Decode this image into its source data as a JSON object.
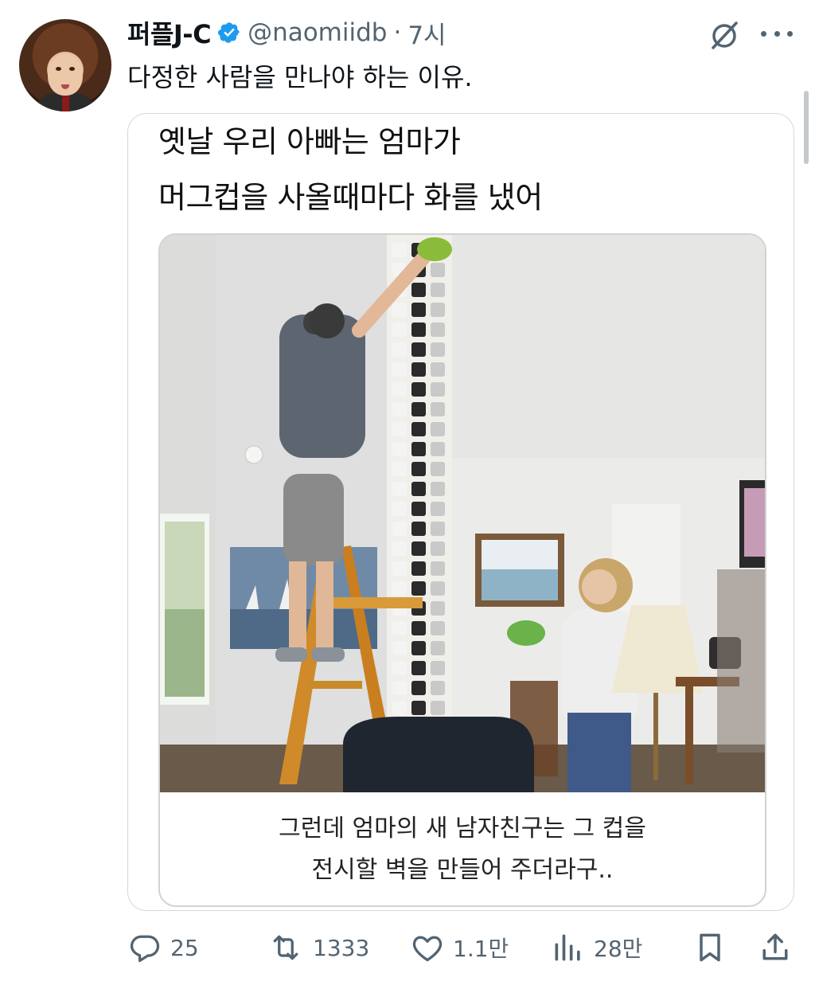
{
  "tweet": {
    "author": {
      "display_name": "퍼플J-C",
      "handle": "@naomiidb",
      "verified": true
    },
    "separator": "·",
    "time": "7시",
    "text": "다정한 사람을 만나야 하는 이유.",
    "media": {
      "caption_top": [
        "옛날 우리 아빠는 엄마가",
        "머그컵을 사올때마다 화를 냈어"
      ],
      "caption_bottom": [
        "그런데 엄마의 새 남자친구는 그 컵을",
        "전시할 벽을 만들어 주더라구.."
      ]
    },
    "actions": {
      "reply": {
        "icon": "reply-icon",
        "count": "25"
      },
      "retweet": {
        "icon": "retweet-icon",
        "count": "1333"
      },
      "like": {
        "icon": "heart-icon",
        "count": "1.1만"
      },
      "views": {
        "icon": "views-icon",
        "count": "28만"
      },
      "bookmark": {
        "icon": "bookmark-icon"
      },
      "share": {
        "icon": "share-icon"
      }
    }
  },
  "colors": {
    "text": "#0f1419",
    "secondary": "#536471",
    "verified": "#1d9bf0",
    "border": "#cfd9de"
  }
}
